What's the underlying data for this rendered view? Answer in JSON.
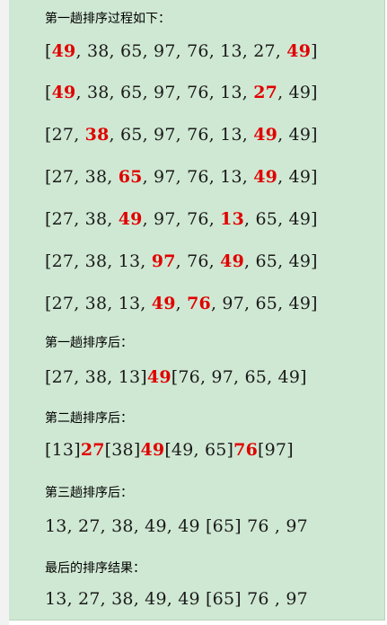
{
  "content": {
    "intro": "第一趟排序过程如下：",
    "pass1_steps": [
      [
        [
          "[",
          0
        ],
        [
          "49",
          1
        ],
        [
          ", 38, 65, 97, 76, 13, 27, ",
          0
        ],
        [
          "49",
          1
        ],
        [
          "]",
          0
        ]
      ],
      [
        [
          "[",
          0
        ],
        [
          "49",
          1
        ],
        [
          ", 38, 65, 97, 76, 13, ",
          0
        ],
        [
          "27",
          1
        ],
        [
          ", 49]",
          0
        ]
      ],
      [
        [
          "[27, ",
          0
        ],
        [
          "38",
          1
        ],
        [
          ", 65, 97, 76, 13, ",
          0
        ],
        [
          "49",
          1
        ],
        [
          ", 49]",
          0
        ]
      ],
      [
        [
          "[27, 38, ",
          0
        ],
        [
          "65",
          1
        ],
        [
          ", 97, 76, 13, ",
          0
        ],
        [
          "49",
          1
        ],
        [
          ", 49]",
          0
        ]
      ],
      [
        [
          "[27, 38, ",
          0
        ],
        [
          "49",
          1
        ],
        [
          ", 97, 76, ",
          0
        ],
        [
          "13",
          1
        ],
        [
          ", 65, 49]",
          0
        ]
      ],
      [
        [
          "[27, 38, 13, ",
          0
        ],
        [
          "97",
          1
        ],
        [
          ", 76, ",
          0
        ],
        [
          "49",
          1
        ],
        [
          ", 65, 49]",
          0
        ]
      ],
      [
        [
          "[27, 38, 13, ",
          0
        ],
        [
          "49",
          1
        ],
        [
          ", ",
          0
        ],
        [
          "76",
          1
        ],
        [
          ", 97, 65, 49]",
          0
        ]
      ]
    ],
    "after_pass1_label": "第一趟排序后：",
    "after_pass1": [
      [
        "[27, 38, 13]",
        0
      ],
      [
        "49",
        1
      ],
      [
        "[76, 97, 65, 49]",
        0
      ]
    ],
    "after_pass2_label": "第二趟排序后：",
    "after_pass2": [
      [
        "[13]",
        0
      ],
      [
        "27",
        1
      ],
      [
        "[38]",
        0
      ],
      [
        "49",
        1
      ],
      [
        "[49, 65]",
        0
      ],
      [
        "76",
        1
      ],
      [
        "[97]",
        0
      ]
    ],
    "after_pass3_label": "第三趟排序后：",
    "after_pass3": [
      [
        "13, 27, 38, 49, 49 [65] 76 , 97",
        0
      ]
    ],
    "final_label": "最后的排序结果：",
    "final_result": [
      [
        "13, 27, 38, 49, 49 [65] 76 , 97",
        0
      ]
    ]
  },
  "colors": {
    "highlight": "#e00000",
    "panel": "#cfe8d3",
    "text": "#1a1a1a"
  }
}
